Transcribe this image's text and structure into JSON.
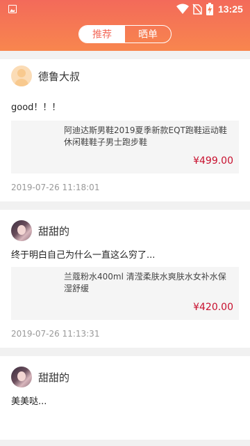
{
  "status_bar": {
    "time": "13:25"
  },
  "tabs": [
    {
      "label": "推荐",
      "active": true
    },
    {
      "label": "晒单",
      "active": false
    }
  ],
  "posts": [
    {
      "username": "德鲁大叔",
      "avatar": "default-avatar",
      "text": "good！！！",
      "product_title": "阿迪达斯男鞋2019夏季新款EQT跑鞋运动鞋休闲鞋鞋子男士跑步鞋",
      "product_price": "¥499.00",
      "timestamp": "2019-07-26 11:18:01"
    },
    {
      "username": "甜甜的",
      "avatar": "photo-avatar",
      "text": "终于明白自己为什么一直这么穷了...",
      "product_title": "兰蔻粉水400ml 清滢柔肤水爽肤水女补水保湿舒缓",
      "product_price": "¥420.00",
      "timestamp": "2019-07-26 11:13:31"
    },
    {
      "username": "甜甜的",
      "avatar": "photo-avatar",
      "text": "美美哒..."
    }
  ],
  "colors": {
    "accent": "#f36a5a",
    "price": "#c8102e"
  }
}
